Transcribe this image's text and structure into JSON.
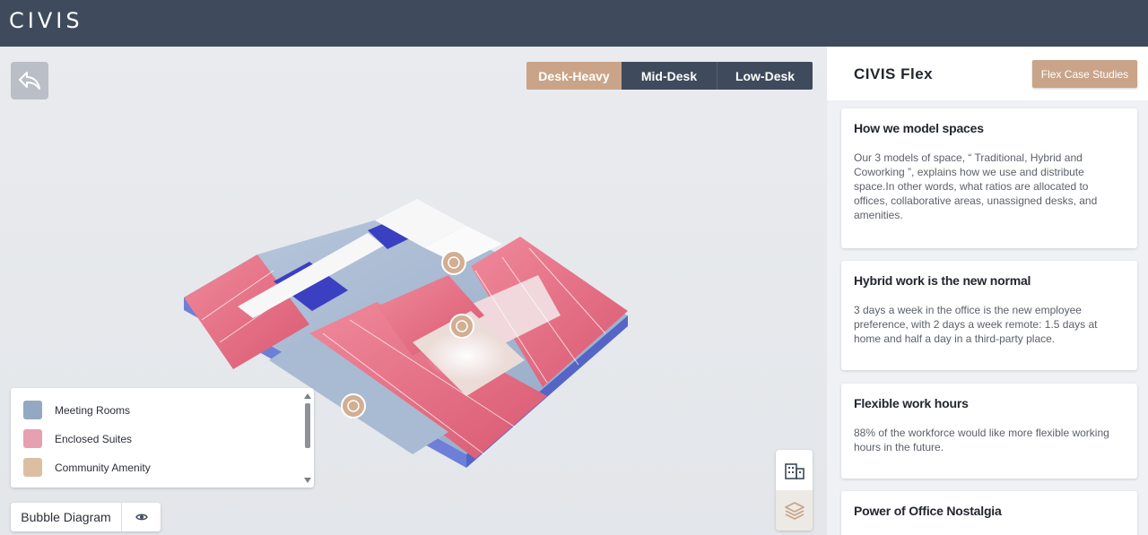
{
  "header": {
    "logo_text": "CIVIS"
  },
  "map": {
    "density_options": [
      "Desk-Heavy",
      "Mid-Desk",
      "Low-Desk"
    ],
    "selected_density": "Desk-Heavy",
    "legend": [
      {
        "label": "Meeting Rooms",
        "color": "#94a8c4"
      },
      {
        "label": "Enclosed Suites",
        "color": "#e6a0b0"
      },
      {
        "label": "Community Amenity",
        "color": "#dcbfa3"
      }
    ],
    "bubble_button": "Bubble Diagram",
    "icons": {
      "back": "back-arrow-icon",
      "eye": "eye-icon",
      "building": "building-icon",
      "layers": "layers-icon"
    }
  },
  "panel": {
    "title": "CIVIS Flex",
    "case_studies_button": "Flex Case Studies",
    "cards": [
      {
        "title": "How we model spaces",
        "body": "Our 3 models of space, “ Traditional, Hybrid and Coworking ”, explains how we use and distribute space.In other words, what ratios are allocated to offices, collaborative areas, unassigned desks, and amenities."
      },
      {
        "title": "Hybrid work is the new normal",
        "body": "3 days a week in the office is the new employee preference, with 2 days a week remote: 1.5 days at home and half a day in a third-party place."
      },
      {
        "title": "Flexible work hours",
        "body": "88% of the workforce would like more flexible working hours in the future."
      },
      {
        "title": "Power of Office Nostalgia",
        "body": ""
      }
    ]
  },
  "colors": {
    "header_bg": "#3f4a5c",
    "accent": "#c9a489",
    "suite_red": "#e0687e",
    "meeting_blue": "#8fa7c8"
  }
}
